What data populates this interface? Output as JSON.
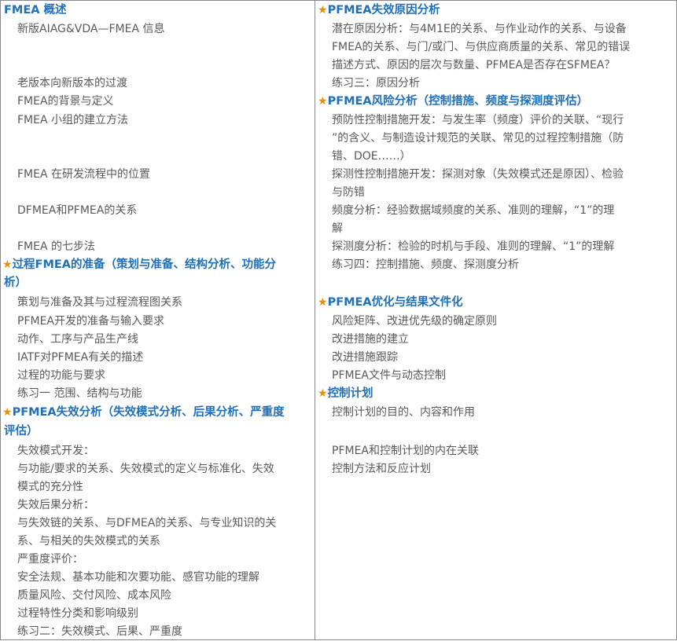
{
  "star_symbol": "★",
  "left": {
    "h1": "FMEA 概述",
    "items1": [
      "新版AIAG&VDA—FMEA 信息",
      "老版本向新版本的过渡",
      "FMEA的背景与定义",
      "FMEA 小组的建立方法",
      "FMEA 在研发流程中的位置",
      "DFMEA和PFMEA的关系",
      "FMEA 的七步法"
    ],
    "h2": [
      "过程FMEA的准备（策划与准备、结构分析、功能分",
      "析）"
    ],
    "items2": [
      "策划与准备及其与过程流程图关系",
      "PFMEA开发的准备与输入要求",
      "动作、工序与产品生产线",
      "IATF对PFMEA有关的描述",
      "过程的功能与要求",
      "练习一 范围、结构与功能"
    ],
    "h3": [
      "PFMEA失效分析（失效模式分析、后果分析、严重度",
      "评估）"
    ],
    "items3": [
      "失效模式开发：",
      "与功能/要求的关系、失效模式的定义与标准化、失效",
      "模式的充分性",
      "失效后果分析：",
      "与失效链的关系、与DFMEA的关系、与专业知识的关",
      "系、与相关的失效模式的关系",
      "严重度评价：",
      "安全法规、基本功能和次要功能、感官功能的理解",
      "质量风险、交付风险、成本风险",
      "过程特性分类和影响级别",
      "练习二：失效模式、后果、严重度"
    ]
  },
  "right": {
    "h1": "PFMEA失效原因分析",
    "items1": [
      "潜在原因分析：与4M1E的关系、与作业动作的关系、与设备",
      "FMEA的关系、与门/或门、与供应商质量的关系、常见的错误",
      "描述方式、原因的层次与数量、PFMEA是否存在SFMEA？",
      "练习三：原因分析"
    ],
    "h2": "PFMEA风险分析（控制措施、频度与探测度评估）",
    "items2": [
      "预防性控制措施开发：与发生率（频度）评价的关联、“现行",
      "”的含义、与制造设计规范的关联、常见的过程控制措施（防",
      "错、DOE……）",
      "探测性控制措施开发：探测对象（失效模式还是原因）、检验",
      "与防错",
      "频度分析：经验数据域频度的关系、准则的理解，“1”的理",
      "解",
      "探测度分析：检验的时机与手段、准则的理解、“1”的理解",
      "练习四：控制措施、频度、探测度分析"
    ],
    "h3": "PFMEA优化与结果文件化",
    "items3": [
      "风险矩阵、改进优先级的确定原则",
      "改进措施的建立",
      "改进措施跟踪",
      "PFMEA文件与动态控制"
    ],
    "h4": "控制计划",
    "items4": [
      "控制计划的目的、内容和作用",
      "PFMEA和控制计划的内在关联",
      "控制方法和反应计划"
    ]
  }
}
